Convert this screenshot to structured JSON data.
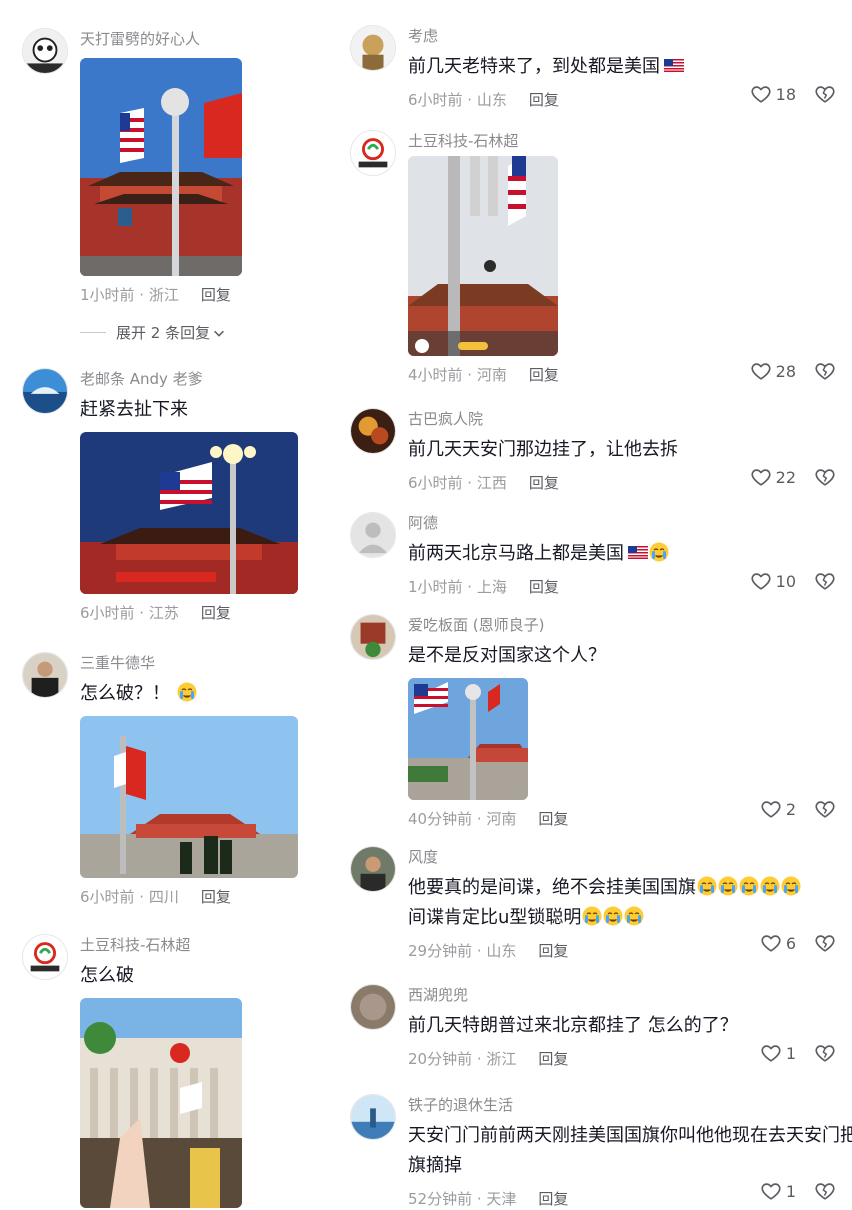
{
  "left_comments": [
    {
      "name": "天打雷劈的好心人",
      "time": "1小时前 · 浙江",
      "reply": "回复",
      "expand": "展开 2 条回复"
    },
    {
      "name": "老邮条 Andy 老爹",
      "text": "赶紧去扯下来",
      "time": "6小时前 · 江苏",
      "reply": "回复"
    },
    {
      "name": "三重牛德华",
      "text": "怎么破？！",
      "time": "6小时前 · 四川",
      "reply": "回复"
    },
    {
      "name": "土豆科技-石林超",
      "text": "怎么破"
    }
  ],
  "right_comments": [
    {
      "name": "考虑",
      "text": "前几天老特来了，到处都是美国",
      "time": "6小时前 · 山东",
      "reply": "回复",
      "likes": "18"
    },
    {
      "name": "土豆科技-石林超",
      "time": "4小时前 · 河南",
      "reply": "回复",
      "likes": "28"
    },
    {
      "name": "古巴疯人院",
      "text": "前几天天安门那边挂了，让他去拆",
      "time": "6小时前 · 江西",
      "reply": "回复",
      "likes": "22"
    },
    {
      "name": "阿德",
      "text": "前两天北京马路上都是美国",
      "time": "1小时前 · 上海",
      "reply": "回复",
      "likes": "10"
    },
    {
      "name": "爱吃板面 (恩师良子)",
      "text": "是不是反对国家这个人？",
      "time": "40分钟前 · 河南",
      "reply": "回复",
      "likes": "2"
    },
    {
      "name": "风度",
      "text": "他要真的是间谍，绝不会挂美国国旗",
      "text2": "间谍肯定比u型锁聪明",
      "time": "29分钟前 · 山东",
      "reply": "回复",
      "likes": "6"
    },
    {
      "name": "西湖兜兜",
      "text": "前几天特朗普过来北京都挂了 怎么的了？",
      "time": "20分钟前 · 浙江",
      "reply": "回复",
      "likes": "1"
    },
    {
      "name": "铁子的退休生活",
      "text": "天安门门前前两天刚挂美国国旗你叫他他现在去天安门把",
      "text2": "旗摘掉",
      "time": "52分钟前 · 天津",
      "reply": "回复",
      "likes": "1"
    }
  ],
  "colors": {
    "accent": "#fe2c55",
    "text": "#161823",
    "meta": "#9b9ba0",
    "name": "#8a8a8f"
  },
  "icons": {
    "like": "heart-icon",
    "dislike": "broken-heart-icon",
    "chevron": "chevron-down-icon"
  }
}
